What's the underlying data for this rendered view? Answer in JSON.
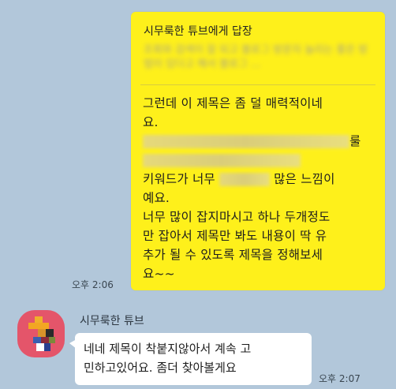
{
  "chat": {
    "outgoing": {
      "reply_header": "시무룩한 튜브에게 답장",
      "quoted_blurred": "조회와 검색이 잘 되고 블로그 방문자 늘리는 좋은 방법이 있다고 해서 블로그 ...",
      "lines": [
        "그런데 이 제목은 좀 덜 매력적이네요.",
        "",
        "키워드가 너무",
        "많은 느낌이 예요.",
        "너무 많이 잡지마시고 하나 두개정도만 잡아서 제목만 봐도 내용이 딱 유추가 될 수 있도록 제목을 정해보세요~~"
      ],
      "line1": "그런데 이 제목은 좀 덜 매력적이네",
      "line2": "요.",
      "line3_end": "룰",
      "line5_pre": "키워드가 너무",
      "line5_post": "많은 느낌이",
      "line6": "예요.",
      "line7": "너무 많이 잡지마시고 하나 두개정도",
      "line8": "만 잡아서 제목만 봐도 내용이 딱 유",
      "line9": "추가 될 수 있도록 제목을 정해보세",
      "line10": "요~~",
      "time": "오후 2:06"
    },
    "incoming": {
      "sender_name": "시무룩한 튜브",
      "line1": "네네 제목이 착붙지않아서 계속 고",
      "line2": "민하고있어요. 좀더 찾아볼게요",
      "time": "오후 2:07"
    }
  },
  "colors": {
    "background": "#b2c7da",
    "outgoing_bubble": "#fef01b",
    "incoming_bubble": "#ffffff",
    "avatar": "#e4556a"
  }
}
